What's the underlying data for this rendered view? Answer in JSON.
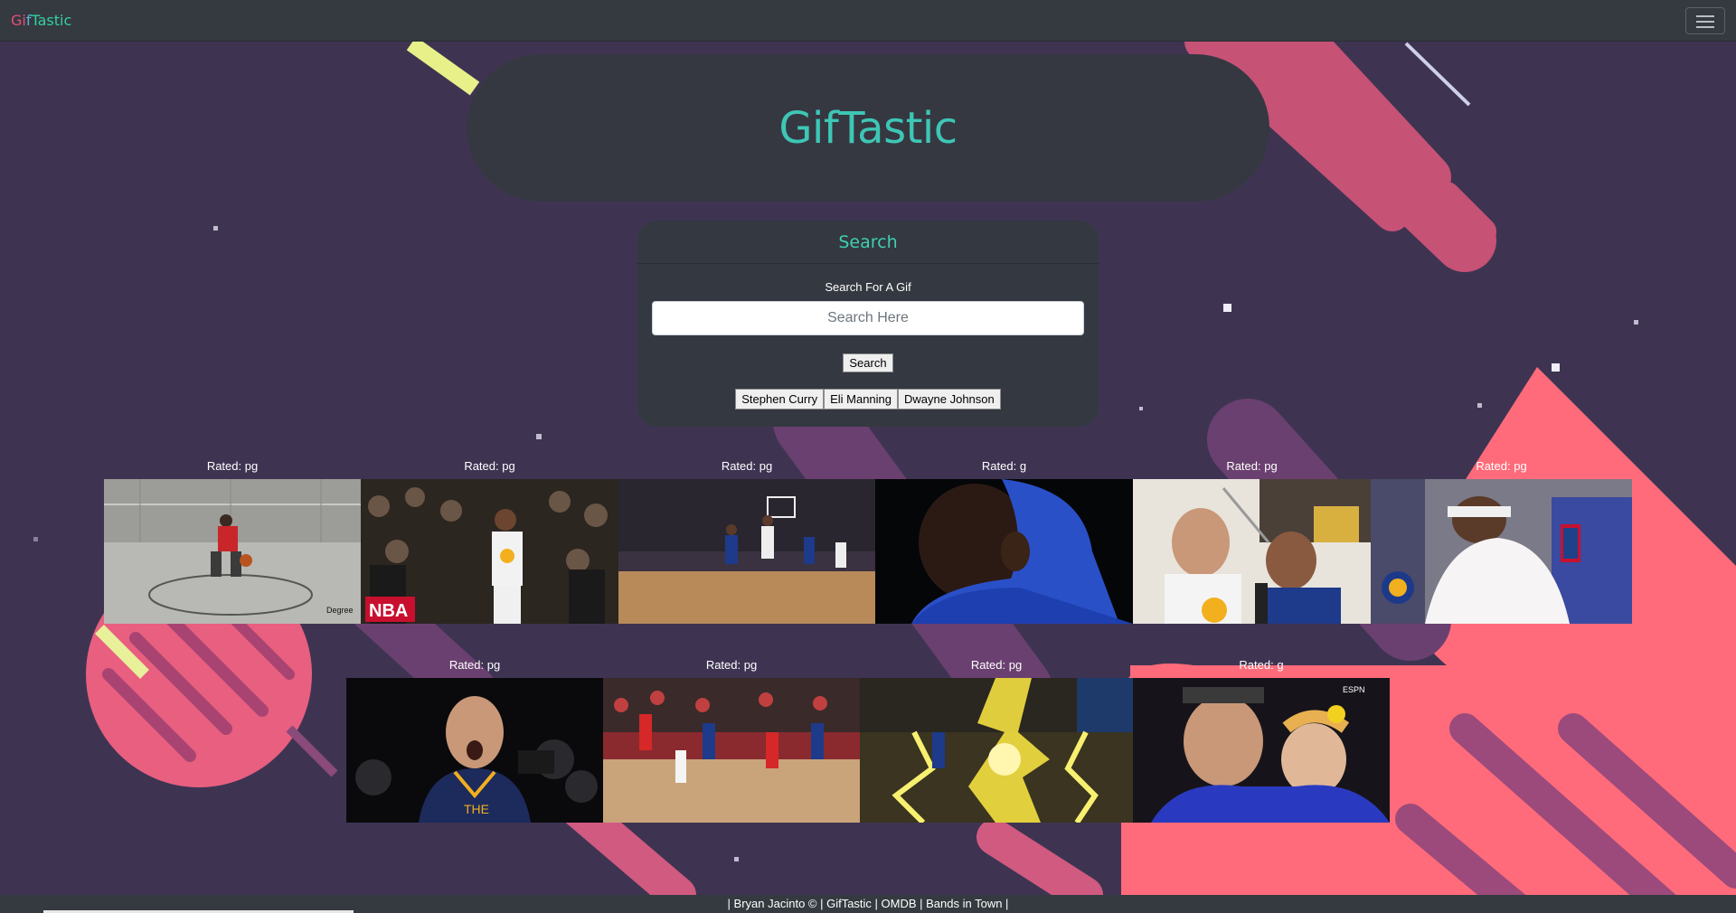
{
  "navbar": {
    "brand_parts": [
      "Gi",
      "f",
      "Tastic"
    ],
    "menu_icon": "hamburger-menu-icon"
  },
  "hero": {
    "title": "GifTastic"
  },
  "search_card": {
    "header": "Search",
    "label": "Search For A Gif",
    "input_placeholder": "Search Here",
    "input_value": "",
    "button_label": "Search",
    "topics": [
      "Stephen Curry",
      "Eli Manning",
      "Dwayne Johnson"
    ]
  },
  "gifs": [
    {
      "rating": "Rated: pg",
      "image": "dribbling-drill-gif"
    },
    {
      "rating": "Rated: pg",
      "image": "curry-on-court-gif"
    },
    {
      "rating": "Rated: pg",
      "image": "fast-break-gif"
    },
    {
      "rating": "Rated: g",
      "image": "player-blue-hoodie-gif"
    },
    {
      "rating": "Rated: pg",
      "image": "curry-interview-gif"
    },
    {
      "rating": "Rated: pg",
      "image": "bench-celebration-gif"
    },
    {
      "rating": "Rated: pg",
      "image": "curry-shout-gif"
    },
    {
      "rating": "Rated: pg",
      "image": "rockets-warriors-game-gif"
    },
    {
      "rating": "Rated: pg",
      "image": "lightning-effect-gif"
    },
    {
      "rating": "Rated: g",
      "image": "curry-with-daughter-gif"
    }
  ],
  "footer": {
    "text": "| Bryan Jacinto © | GifTastic | OMDB | Bands in Town |"
  },
  "colors": {
    "background": "#3e3452",
    "navbar": "#343a40",
    "accent_teal": "#3ec6b6",
    "pink": "#ff6b7a"
  }
}
